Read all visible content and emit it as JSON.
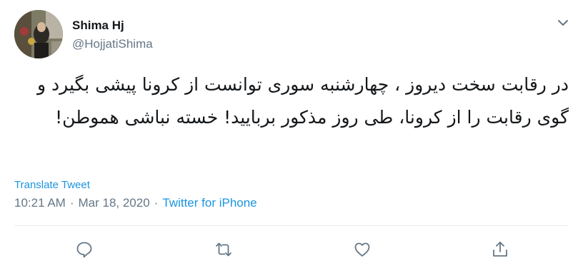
{
  "author": {
    "name": "Shima Hj",
    "handle": "@HojjatiShima"
  },
  "tweet": {
    "text": "در رقابت سخت دیروز ، چهارشنبه سوری توانست از کرونا پیشی بگیرد و گوی رقابت را از کرونا، طی روز مذکور بربایید! خسته نباشی هموطن!"
  },
  "translate_label": "Translate Tweet",
  "meta": {
    "time": "10:21 AM",
    "separator": "·",
    "date": "Mar 18, 2020",
    "source": "Twitter for iPhone"
  },
  "icons": {
    "more": "chevron-down-icon",
    "reply": "reply-icon",
    "retweet": "retweet-icon",
    "like": "like-icon",
    "share": "share-icon"
  },
  "colors": {
    "link": "#1b95e0",
    "secondary_text": "#657786",
    "primary_text": "#14171a",
    "divider": "#e6ecf0"
  }
}
